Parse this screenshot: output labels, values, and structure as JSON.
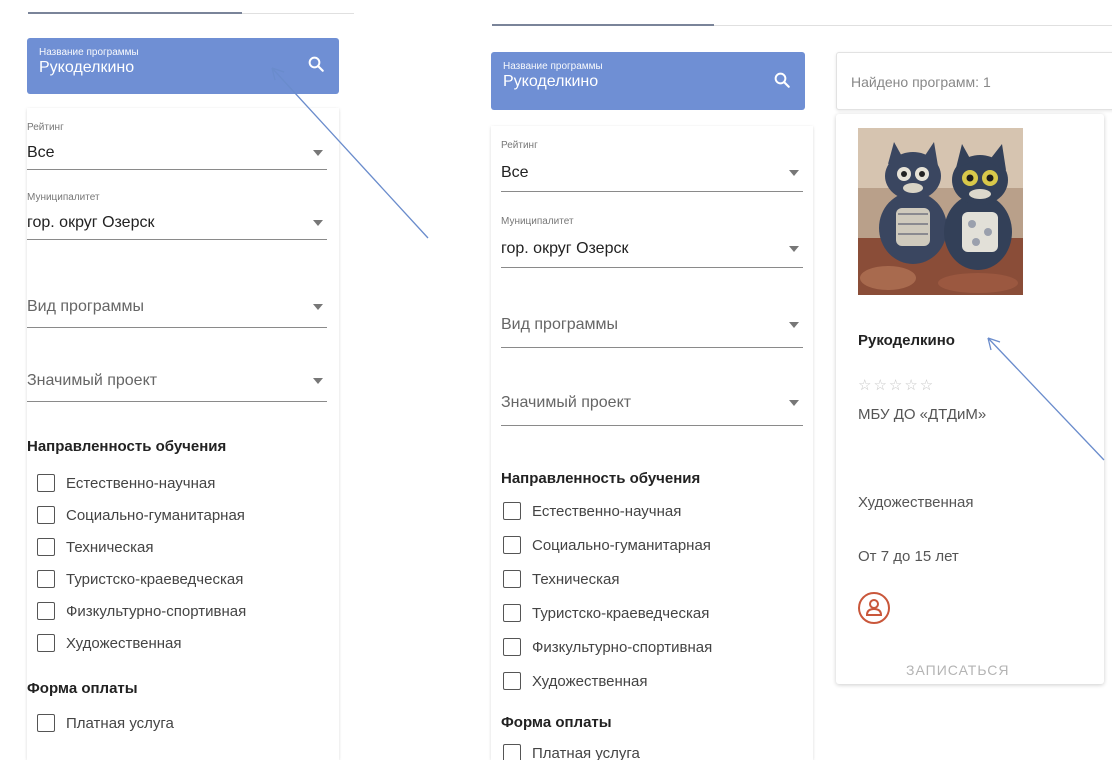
{
  "search": {
    "label": "Название программы",
    "value": "Рукоделкино"
  },
  "filters": {
    "rating": {
      "label": "Рейтинг",
      "value": "Все"
    },
    "municipality": {
      "label": "Муниципалитет",
      "value": "гор. округ Озерск"
    },
    "program_type": {
      "placeholder": "Вид программы"
    },
    "significant_project": {
      "placeholder": "Значимый проект"
    },
    "direction": {
      "title": "Направленность обучения",
      "options": [
        "Естественно-научная",
        "Социально-гуманитарная",
        "Техническая",
        "Туристско-краеведческая",
        "Физкультурно-спортивная",
        "Художественная"
      ]
    },
    "payment": {
      "title": "Форма оплаты",
      "options": [
        "Платная услуга"
      ]
    }
  },
  "results": {
    "found_text": "Найдено программ: 1"
  },
  "program": {
    "title": "Рукоделкино",
    "rating_stars": "☆☆☆☆☆",
    "organization": "МБУ ДО «ДТДиМ»",
    "direction": "Художественная",
    "age": "От 7 до 15 лет",
    "enroll_label": "ЗАПИСАТЬСЯ",
    "icon": "person-icon"
  },
  "colors": {
    "search_bg": "#6f8fd4",
    "accent_icon": "#c9573b",
    "arrow": "#6a8ccc"
  }
}
